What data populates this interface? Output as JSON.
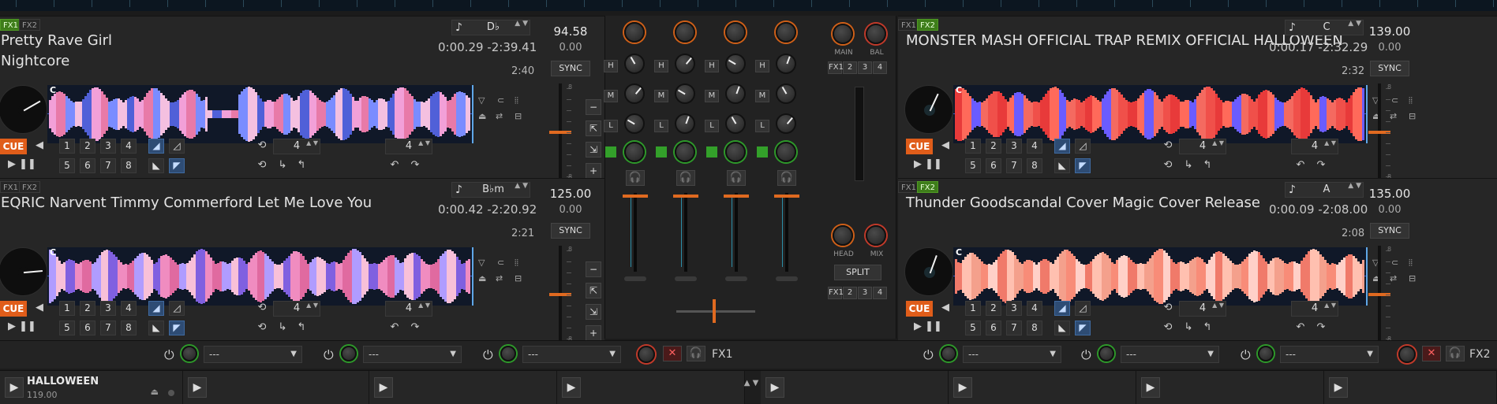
{
  "decks": [
    {
      "id": "deck1",
      "fx": [
        "FX1",
        "FX2"
      ],
      "fx_active": [
        true,
        false
      ],
      "title": "Pretty Rave Girl",
      "artist": "Nightcore",
      "elapsed": "0:00.29",
      "remaining": "-2:39.41",
      "duration": "2:40",
      "key": "D♭",
      "bpm": "94.58",
      "rate": "0.00",
      "sync": "SYNC",
      "cue": "CUE",
      "wave_color": "pink-blue",
      "loop_size": "4",
      "jump_size": "4"
    },
    {
      "id": "deck2",
      "fx": [
        "FX1",
        "FX2"
      ],
      "fx_active": [
        false,
        true
      ],
      "title": "MONSTER MASH OFFICIAL TRAP REMIX OFFICIAL HALLOWEEN",
      "artist": "",
      "elapsed": "0:00.17",
      "remaining": "-2:32.29",
      "duration": "2:32",
      "key": "C",
      "bpm": "139.00",
      "rate": "0.00",
      "sync": "SYNC",
      "cue": "CUE",
      "wave_color": "red",
      "loop_size": "4",
      "jump_size": "4"
    },
    {
      "id": "deck3",
      "fx": [
        "FX1",
        "FX2"
      ],
      "fx_active": [
        false,
        false
      ],
      "title": "EQRIC Narvent Timmy Commerford  Let Me Love You",
      "artist": "",
      "elapsed": "0:00.42",
      "remaining": "-2:20.92",
      "duration": "2:21",
      "key": "B♭m",
      "bpm": "125.00",
      "rate": "0.00",
      "sync": "SYNC",
      "cue": "CUE",
      "wave_color": "pink-purple",
      "loop_size": "4",
      "jump_size": "4"
    },
    {
      "id": "deck4",
      "fx": [
        "FX1",
        "FX2"
      ],
      "fx_active": [
        false,
        true
      ],
      "title": "Thunder Goodscandal  Cover Magic Cover Release",
      "artist": "",
      "elapsed": "0:00.09",
      "remaining": "-2:08.00",
      "duration": "2:08",
      "key": "A",
      "bpm": "135.00",
      "rate": "0.00",
      "sync": "SYNC",
      "cue": "CUE",
      "wave_color": "salmon",
      "loop_size": "4",
      "jump_size": "4"
    }
  ],
  "hotcues": [
    "1",
    "2",
    "3",
    "4",
    "5",
    "6",
    "7",
    "8"
  ],
  "wave_marker": "C",
  "pitch_scale": {
    "top": "8",
    "bottom": "8"
  },
  "icons": {
    "note": "♪",
    "play_pause": "▶ ❚❚",
    "back": "◀",
    "up_down": "▲▼",
    "plus": "+",
    "minus": "−"
  },
  "mixer": {
    "eq_labels": [
      "H",
      "M",
      "L"
    ],
    "main_label": "MAIN",
    "bal_label": "BAL",
    "head_label": "HEAD",
    "mix_label": "MIX",
    "split_label": "SPLIT",
    "fx_units": [
      "FX1",
      "2",
      "3",
      "4"
    ]
  },
  "fx_row": {
    "left_label": "FX1",
    "right_label": "FX2",
    "slot_value": "---"
  },
  "samplers": [
    {
      "name": "HALLOWEEN",
      "bpm": "119.00"
    },
    {
      "name": "",
      "bpm": ""
    },
    {
      "name": "",
      "bpm": ""
    },
    {
      "name": "",
      "bpm": ""
    },
    {
      "name": "",
      "bpm": ""
    },
    {
      "name": "",
      "bpm": ""
    },
    {
      "name": "",
      "bpm": ""
    },
    {
      "name": "",
      "bpm": ""
    }
  ],
  "colors": {
    "accent_orange": "#e05d1a",
    "fx_active_green": "#3e7d1a",
    "sync_blue": "#2e4c74"
  }
}
